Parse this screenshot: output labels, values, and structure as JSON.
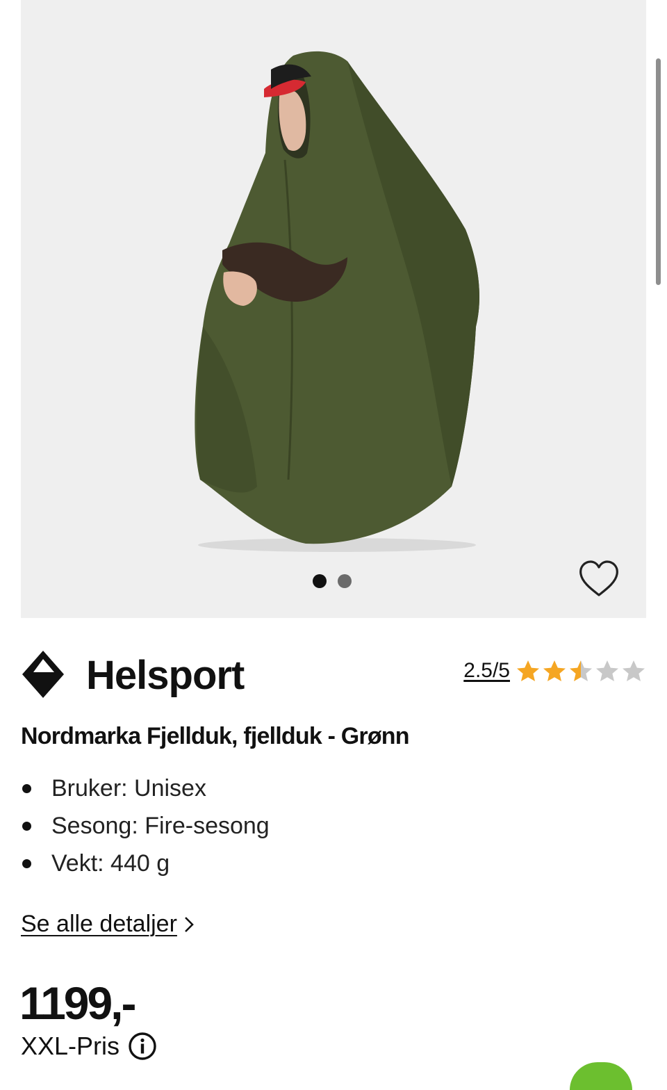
{
  "gallery": {
    "image_alt": "Person sitting wearing a green rain poncho (fjellduk) and a red cap",
    "slide_count": 2,
    "active_slide": 1,
    "favorite_icon": "heart-outline-icon"
  },
  "brand": {
    "name": "Helsport",
    "logo_icon": "helsport-diamond-logo"
  },
  "rating": {
    "text": "2.5/5",
    "value": 2.5,
    "max": 5,
    "star_color": "#f5a623",
    "empty_star_color": "#c8c8c8"
  },
  "product": {
    "title": "Nordmarka Fjellduk, fjellduk - Grønn",
    "specs": [
      "Bruker: Unisex",
      "Sesong: Fire-sesong",
      "Vekt: 440 g"
    ],
    "details_link": "Se alle detaljer"
  },
  "price": {
    "amount": "1199,-",
    "label": "XXL-Pris",
    "info_icon": "info-circle-icon"
  },
  "colors": {
    "accent_green": "#6cbf2f",
    "text": "#111111"
  }
}
